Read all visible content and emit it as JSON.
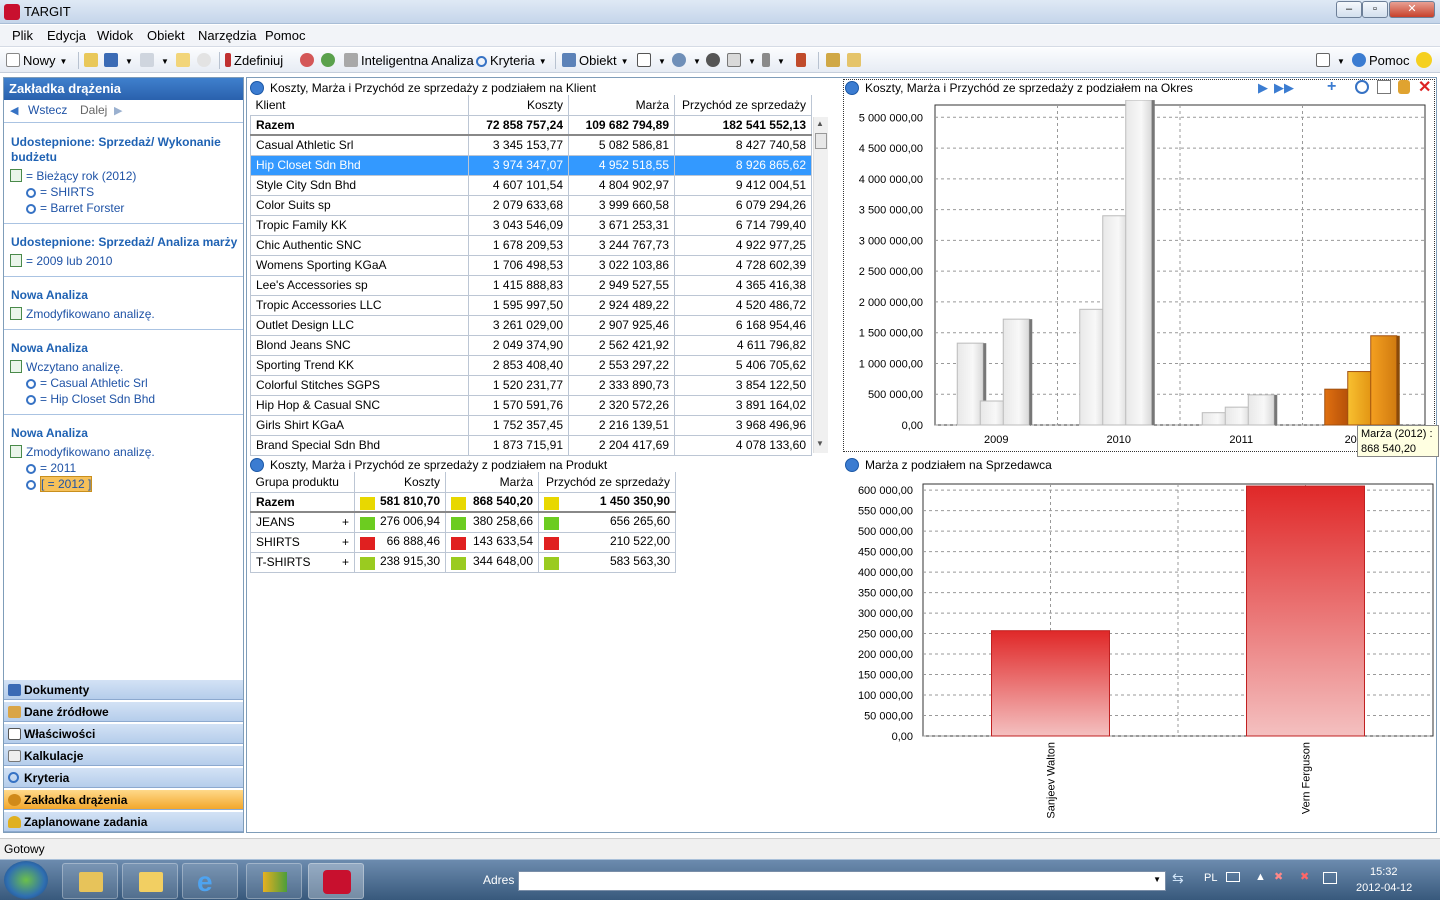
{
  "window": {
    "title": "TARGIT"
  },
  "menu": [
    "Plik",
    "Edycja",
    "Widok",
    "Obiekt",
    "Narzędzia",
    "Pomoc"
  ],
  "toolbar": {
    "new": "Nowy",
    "define": "Zdefiniuj",
    "smart": "Inteligentna Analiza",
    "criteria": "Kryteria",
    "object": "Obiekt",
    "help": "Pomoc"
  },
  "left": {
    "header": "Zakładka drążenia",
    "back": "Wstecz",
    "next": "Dalej",
    "sections": [
      {
        "title": "Udostepnione: Sprzedaż/ Wykonanie budżetu",
        "items": [
          "= Bieżący rok (2012)",
          "= SHIRTS",
          "= Barret Forster"
        ]
      },
      {
        "title": "Udostepnione: Sprzedaż/ Analiza marży",
        "items": [
          "= 2009 lub 2010"
        ]
      },
      {
        "title": "Nowa Analiza",
        "items": [
          "Zmodyfikowano analizę."
        ]
      },
      {
        "title": "Nowa Analiza",
        "items": [
          "Wczytano analizę.",
          "= Casual Athletic Srl",
          "= Hip Closet Sdn Bhd"
        ]
      },
      {
        "title": "Nowa Analiza",
        "items": [
          "Zmodyfikowano analizę.",
          "= 2011",
          "[ = 2012 ]"
        ]
      }
    ],
    "tabs": [
      "Dokumenty",
      "Dane źródłowe",
      "Właściwości",
      "Kalkulacje",
      "Kryteria",
      "Zakładka drążenia",
      "Zaplanowane zadania"
    ]
  },
  "table1": {
    "title": "Koszty, Marża i Przychód ze sprzedaży z podziałem na Klient",
    "columns": [
      "Klient",
      "Koszty",
      "Marża",
      "Przychód ze sprzedaży"
    ],
    "total": [
      "Razem",
      "72 858 757,24",
      "109 682 794,89",
      "182 541 552,13"
    ],
    "rows": [
      [
        "Casual Athletic Srl",
        "3 345 153,77",
        "5 082 586,81",
        "8 427 740,58"
      ],
      [
        "Hip Closet Sdn Bhd",
        "3 974 347,07",
        "4 952 518,55",
        "8 926 865,62"
      ],
      [
        "Style City Sdn Bhd",
        "4 607 101,54",
        "4 804 902,97",
        "9 412 004,51"
      ],
      [
        "Color Suits sp",
        "2 079 633,68",
        "3 999 660,58",
        "6 079 294,26"
      ],
      [
        "Tropic Family KK",
        "3 043 546,09",
        "3 671 253,31",
        "6 714 799,40"
      ],
      [
        "Chic Authentic SNC",
        "1 678 209,53",
        "3 244 767,73",
        "4 922 977,25"
      ],
      [
        "Womens Sporting KGaA",
        "1 706 498,53",
        "3 022 103,86",
        "4 728 602,39"
      ],
      [
        "Lee's Accessories sp",
        "1 415 888,83",
        "2 949 527,55",
        "4 365 416,38"
      ],
      [
        "Tropic Accessories LLC",
        "1 595 997,50",
        "2 924 489,22",
        "4 520 486,72"
      ],
      [
        "Outlet Design LLC",
        "3 261 029,00",
        "2 907 925,46",
        "6 168 954,46"
      ],
      [
        "Blond Jeans SNC",
        "2 049 374,90",
        "2 562 421,92",
        "4 611 796,82"
      ],
      [
        "Sporting Trend KK",
        "2 853 408,40",
        "2 553 297,22",
        "5 406 705,62"
      ],
      [
        "Colorful Stitches SGPS",
        "1 520 231,77",
        "2 333 890,73",
        "3 854 122,50"
      ],
      [
        "Hip Hop & Casual SNC",
        "1 570 591,76",
        "2 320 572,26",
        "3 891 164,02"
      ],
      [
        "Girls Shirt KGaA",
        "1 752 357,45",
        "2 216 139,51",
        "3 968 496,96"
      ],
      [
        "Brand Special Sdn Bhd",
        "1 873 715,91",
        "2 204 417,69",
        "4 078 133,60"
      ]
    ]
  },
  "table2": {
    "title": "Koszty, Marża i Przychód ze sprzedaży z podziałem na Produkt",
    "columns": [
      "Grupa produktu",
      "Koszty",
      "Marża",
      "Przychód ze sprzedaży"
    ],
    "total": [
      "Razem",
      "581 810,70",
      "868 540,20",
      "1 450 350,90"
    ],
    "rows": [
      [
        "JEANS",
        "276 006,94",
        "380 258,66",
        "656 265,60"
      ],
      [
        "SHIRTS",
        "66 888,46",
        "143 633,54",
        "210 522,00"
      ],
      [
        "T-SHIRTS",
        "238 915,30",
        "344 648,00",
        "583 563,30"
      ]
    ],
    "colors": {
      "total": [
        "#e8d800",
        "#e8d800",
        "#e8d800"
      ],
      "rows": [
        [
          "#6ccc20",
          "#6ccc20",
          "#6ccc20"
        ],
        [
          "#e02020",
          "#e02020",
          "#e02020"
        ],
        [
          "#9acb20",
          "#9acb20",
          "#9acb20"
        ]
      ]
    }
  },
  "chart1_title": "Koszty, Marża i Przychód ze sprzedaży z podziałem na Okres",
  "chart2_title": "Marża z podziałem na Sprzedawca",
  "tooltip": {
    "line1": "Marża (2012) :",
    "line2": "868 540,20"
  },
  "chart_data": [
    {
      "type": "bar",
      "title": "Koszty, Marża i Przychód ze sprzedaży z podziałem na Okres",
      "categories": [
        "2009",
        "2010",
        "2011",
        "2012"
      ],
      "series": [
        {
          "values": [
            1330000,
            1880000,
            200000,
            582000
          ]
        },
        {
          "values": [
            390000,
            3400000,
            290000,
            868540
          ]
        },
        {
          "values": [
            1720000,
            5280000,
            490000,
            1450000
          ]
        }
      ],
      "ylim": [
        0,
        5200000
      ],
      "yticks": [
        "0,00",
        "500 000,00",
        "1 000 000,00",
        "1 500 000,00",
        "2 000 000,00",
        "2 500 000,00",
        "3 000 000,00",
        "3 500 000,00",
        "4 000 000,00",
        "4 500 000,00",
        "5 000 000,00"
      ],
      "ytick_values": [
        0,
        500000,
        1000000,
        1500000,
        2000000,
        2500000,
        3000000,
        3500000,
        4000000,
        4500000,
        5000000
      ],
      "xtick_labels": [
        "2009",
        "2010",
        "2011",
        "201"
      ]
    },
    {
      "type": "bar",
      "title": "Marża z podziałem na Sprzedawca",
      "categories": [
        "Sanjeev Walton",
        "Vern Ferguson"
      ],
      "values": [
        257000,
        610000
      ],
      "ylim": [
        0,
        615000
      ],
      "yticks": [
        "0,00",
        "50 000,00",
        "100 000,00",
        "150 000,00",
        "200 000,00",
        "250 000,00",
        "300 000,00",
        "350 000,00",
        "400 000,00",
        "450 000,00",
        "500 000,00",
        "550 000,00",
        "600 000,00"
      ],
      "ytick_values": [
        0,
        50000,
        100000,
        150000,
        200000,
        250000,
        300000,
        350000,
        400000,
        450000,
        500000,
        550000,
        600000
      ]
    }
  ],
  "status": "Gotowy",
  "taskbar": {
    "address_label": "Adres",
    "lang": "PL",
    "time": "15:32",
    "date": "2012-04-12"
  }
}
